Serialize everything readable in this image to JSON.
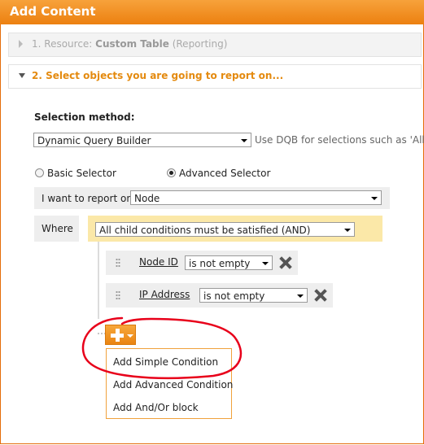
{
  "window": {
    "title": "Add Content"
  },
  "steps": {
    "step1_prefix": "1. Resource: ",
    "step1_name": "Custom Table",
    "step1_suffix": " (Reporting)",
    "step2": "2. Select objects you are going to report on..."
  },
  "selection": {
    "label": "Selection method:",
    "value": "Dynamic Query Builder",
    "hint": "Use DQB for selections such as 'All"
  },
  "selector": {
    "basic_label": "Basic Selector",
    "advanced_label": "Advanced Selector",
    "selected": "Advanced Selector"
  },
  "report": {
    "label": "I want to report on",
    "value": "Node"
  },
  "where": {
    "label": "Where",
    "logic_value": "All child conditions must be satisfied (AND)"
  },
  "conditions": [
    {
      "field": "Node ID",
      "operator": "is not empty"
    },
    {
      "field": "IP Address",
      "operator": "is not empty"
    }
  ],
  "add_menu": {
    "items": [
      "Add Simple Condition",
      "Add Advanced Condition",
      "Add And/Or block"
    ]
  },
  "colors": {
    "accent": "#f28c1b",
    "highlight_row": "#fbe8a8",
    "annotation": "#e8001a",
    "step_active": "#e48a0f"
  }
}
